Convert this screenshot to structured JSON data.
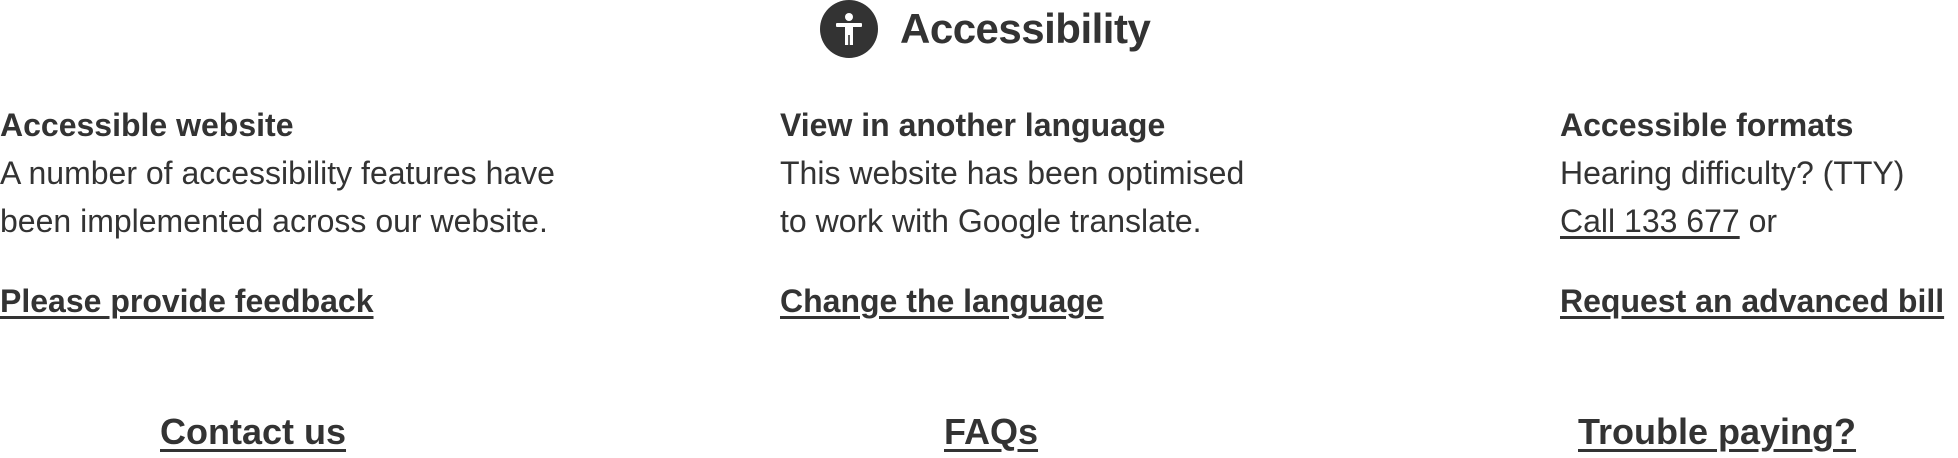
{
  "header": {
    "title": "Accessibility",
    "icon": "accessibility-person-icon"
  },
  "columns": [
    {
      "heading": "Accessible website",
      "body_lines": [
        "A number of accessibility features have",
        "been implemented across our website."
      ],
      "link": "Please provide feedback"
    },
    {
      "heading": "View in another language",
      "body_lines": [
        "This website has been optimised",
        "to work with Google translate."
      ],
      "link": "Change the language"
    },
    {
      "heading": "Accessible formats",
      "body_lines": [
        "Hearing difficulty? (TTY)"
      ],
      "call_link": "Call 133 677",
      "call_suffix": " or",
      "link": "Request an advanced bill"
    }
  ],
  "bottom_links": [
    "Contact us",
    "FAQs",
    "Trouble paying?"
  ],
  "colors": {
    "text": "#333333",
    "background": "#ffffff"
  }
}
